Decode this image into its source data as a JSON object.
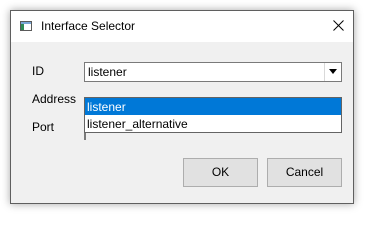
{
  "window": {
    "title": "Interface Selector"
  },
  "form": {
    "id_label": "ID",
    "address_label": "Address",
    "port_label": "Port",
    "id_value": "listener"
  },
  "dropdown": {
    "options": [
      "listener",
      "listener_alternative"
    ],
    "selected_index": 0
  },
  "buttons": {
    "ok": "OK",
    "cancel": "Cancel"
  },
  "colors": {
    "selection": "#0078d7",
    "dialog_bg": "#f0f0f0"
  }
}
